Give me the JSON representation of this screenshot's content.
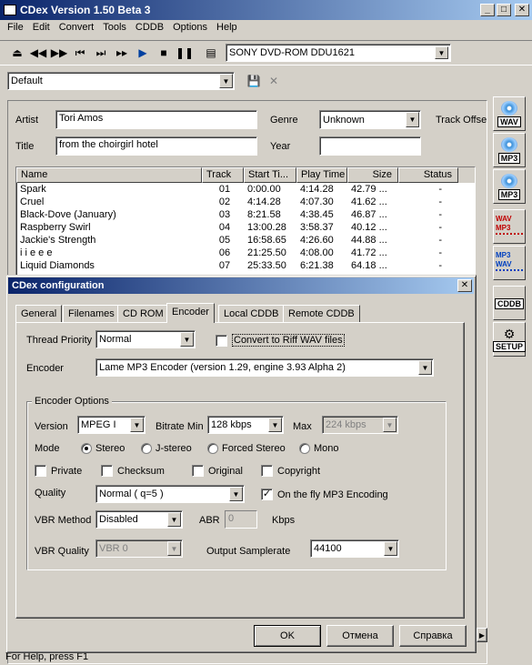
{
  "app": {
    "title": "CDex Version 1.50 Beta 3"
  },
  "menu": [
    "File",
    "Edit",
    "Convert",
    "Tools",
    "CDDB",
    "Options",
    "Help"
  ],
  "toolbar": {
    "drive": "SONY    DVD-ROM DDU1621",
    "profile": "Default"
  },
  "disc": {
    "artist_label": "Artist",
    "artist": "Tori Amos",
    "title_label": "Title",
    "title": "from the choirgirl hotel",
    "genre_label": "Genre",
    "genre": "Unknown",
    "year_label": "Year",
    "year": "",
    "track_offset_label": "Track Offse"
  },
  "tracklist": {
    "columns": [
      "Name",
      "Track",
      "Start Ti...",
      "Play Time",
      "Size",
      "Status"
    ],
    "rows": [
      [
        "Spark",
        "01",
        "0:00.00",
        "4:14.28",
        "42.79 ...",
        "-"
      ],
      [
        "Cruel",
        "02",
        "4:14.28",
        "4:07.30",
        "41.62 ...",
        "-"
      ],
      [
        "Black-Dove (January)",
        "03",
        "8:21.58",
        "4:38.45",
        "46.87 ...",
        "-"
      ],
      [
        "Raspberry Swirl",
        "04",
        "13:00.28",
        "3:58.37",
        "40.12 ...",
        "-"
      ],
      [
        "Jackie's Strength",
        "05",
        "16:58.65",
        "4:26.60",
        "44.88 ...",
        "-"
      ],
      [
        "i i e e e",
        "06",
        "21:25.50",
        "4:08.00",
        "41.72 ...",
        "-"
      ],
      [
        "Liquid Diamonds",
        "07",
        "25:33.50",
        "6:21.38",
        "64.18 ...",
        "-"
      ]
    ]
  },
  "sidebar": [
    "WAV",
    "MP3",
    "MP3",
    "WAV MP3",
    "MP3 WAV",
    "CDDB",
    "SETUP"
  ],
  "status_text": "For Help, press F1",
  "dialog": {
    "title": "CDex configuration",
    "tabs": [
      "General",
      "Filenames",
      "CD ROM",
      "Encoder",
      "Local CDDB",
      "Remote CDDB"
    ],
    "thread_priority_label": "Thread Priority",
    "thread_priority": "Normal",
    "riff_label": "Convert to Riff WAV files",
    "encoder_label": "Encoder",
    "encoder": "Lame MP3 Encoder (version 1.29, engine 3.93 Alpha 2)",
    "options_group": "Encoder Options",
    "version_label": "Version",
    "version": "MPEG I",
    "bitrate_min_label": "Bitrate Min",
    "bitrate_min": "128 kbps",
    "max_label": "Max",
    "max": "224 kbps",
    "mode_label": "Mode",
    "modes": [
      "Stereo",
      "J-stereo",
      "Forced Stereo",
      "Mono"
    ],
    "private_label": "Private",
    "checksum_label": "Checksum",
    "original_label": "Original",
    "copyright_label": "Copyright",
    "quality_label": "Quality",
    "quality": "Normal ( q=5 )",
    "onthefly_label": "On the fly MP3 Encoding",
    "vbr_method_label": "VBR Method",
    "vbr_method": "Disabled",
    "abr_label": "ABR",
    "abr": "0",
    "kbps_label": "Kbps",
    "vbr_quality_label": "VBR Quality",
    "vbr_quality": "VBR 0",
    "samplerate_label": "Output Samplerate",
    "samplerate": "44100",
    "ok": "OK",
    "cancel": "Отмена",
    "help": "Справка"
  }
}
